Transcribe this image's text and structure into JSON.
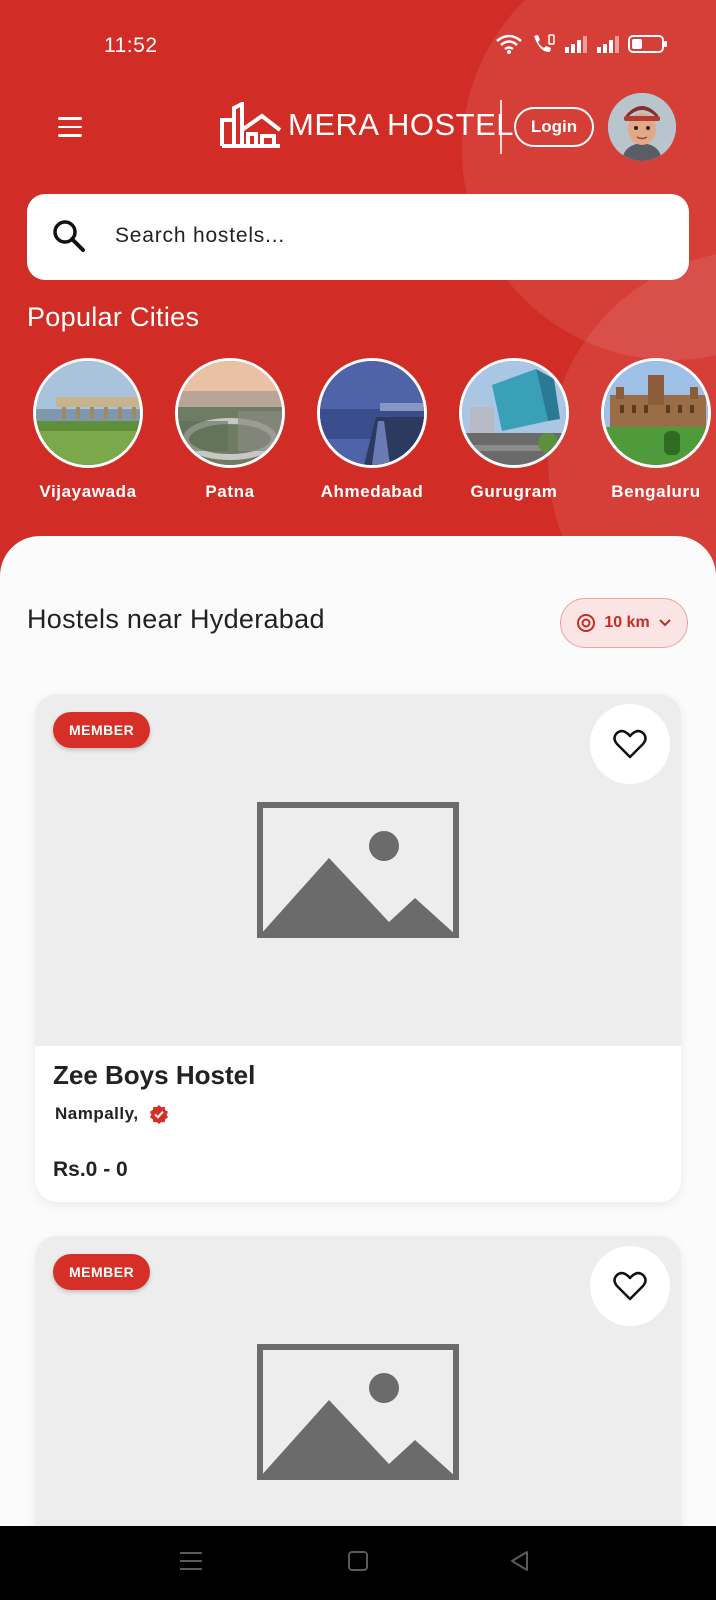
{
  "status_bar": {
    "time": "11:52"
  },
  "header": {
    "logo_text": "MERA HOSTEL",
    "login_label": "Login"
  },
  "search": {
    "placeholder": "Search hostels..."
  },
  "popular_cities": {
    "title": "Popular Cities",
    "cities": [
      {
        "name": "Vijayawada"
      },
      {
        "name": "Patna"
      },
      {
        "name": "Ahmedabad"
      },
      {
        "name": "Gurugram"
      },
      {
        "name": "Bengaluru"
      }
    ]
  },
  "listing": {
    "title": "Hostels near Hyderabad",
    "distance_filter": "10 km",
    "cards": [
      {
        "badge": "MEMBER",
        "name": "Zee Boys Hostel",
        "location": "Nampally,",
        "price": "Rs.0 - 0"
      },
      {
        "badge": "MEMBER"
      }
    ]
  },
  "colors": {
    "brand": "#d12c25",
    "badge": "#d52f28",
    "placeholder": "#6b6b6b"
  }
}
